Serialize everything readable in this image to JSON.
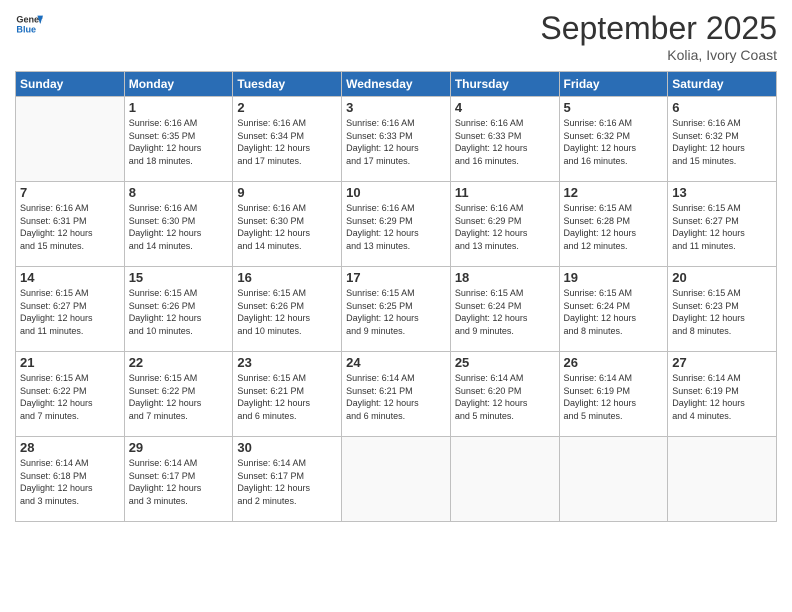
{
  "logo": {
    "line1": "General",
    "line2": "Blue"
  },
  "title": "September 2025",
  "subtitle": "Kolia, Ivory Coast",
  "days_header": [
    "Sunday",
    "Monday",
    "Tuesday",
    "Wednesday",
    "Thursday",
    "Friday",
    "Saturday"
  ],
  "weeks": [
    [
      {
        "day": "",
        "info": ""
      },
      {
        "day": "1",
        "info": "Sunrise: 6:16 AM\nSunset: 6:35 PM\nDaylight: 12 hours\nand 18 minutes."
      },
      {
        "day": "2",
        "info": "Sunrise: 6:16 AM\nSunset: 6:34 PM\nDaylight: 12 hours\nand 17 minutes."
      },
      {
        "day": "3",
        "info": "Sunrise: 6:16 AM\nSunset: 6:33 PM\nDaylight: 12 hours\nand 17 minutes."
      },
      {
        "day": "4",
        "info": "Sunrise: 6:16 AM\nSunset: 6:33 PM\nDaylight: 12 hours\nand 16 minutes."
      },
      {
        "day": "5",
        "info": "Sunrise: 6:16 AM\nSunset: 6:32 PM\nDaylight: 12 hours\nand 16 minutes."
      },
      {
        "day": "6",
        "info": "Sunrise: 6:16 AM\nSunset: 6:32 PM\nDaylight: 12 hours\nand 15 minutes."
      }
    ],
    [
      {
        "day": "7",
        "info": "Sunrise: 6:16 AM\nSunset: 6:31 PM\nDaylight: 12 hours\nand 15 minutes."
      },
      {
        "day": "8",
        "info": "Sunrise: 6:16 AM\nSunset: 6:30 PM\nDaylight: 12 hours\nand 14 minutes."
      },
      {
        "day": "9",
        "info": "Sunrise: 6:16 AM\nSunset: 6:30 PM\nDaylight: 12 hours\nand 14 minutes."
      },
      {
        "day": "10",
        "info": "Sunrise: 6:16 AM\nSunset: 6:29 PM\nDaylight: 12 hours\nand 13 minutes."
      },
      {
        "day": "11",
        "info": "Sunrise: 6:16 AM\nSunset: 6:29 PM\nDaylight: 12 hours\nand 13 minutes."
      },
      {
        "day": "12",
        "info": "Sunrise: 6:15 AM\nSunset: 6:28 PM\nDaylight: 12 hours\nand 12 minutes."
      },
      {
        "day": "13",
        "info": "Sunrise: 6:15 AM\nSunset: 6:27 PM\nDaylight: 12 hours\nand 11 minutes."
      }
    ],
    [
      {
        "day": "14",
        "info": "Sunrise: 6:15 AM\nSunset: 6:27 PM\nDaylight: 12 hours\nand 11 minutes."
      },
      {
        "day": "15",
        "info": "Sunrise: 6:15 AM\nSunset: 6:26 PM\nDaylight: 12 hours\nand 10 minutes."
      },
      {
        "day": "16",
        "info": "Sunrise: 6:15 AM\nSunset: 6:26 PM\nDaylight: 12 hours\nand 10 minutes."
      },
      {
        "day": "17",
        "info": "Sunrise: 6:15 AM\nSunset: 6:25 PM\nDaylight: 12 hours\nand 9 minutes."
      },
      {
        "day": "18",
        "info": "Sunrise: 6:15 AM\nSunset: 6:24 PM\nDaylight: 12 hours\nand 9 minutes."
      },
      {
        "day": "19",
        "info": "Sunrise: 6:15 AM\nSunset: 6:24 PM\nDaylight: 12 hours\nand 8 minutes."
      },
      {
        "day": "20",
        "info": "Sunrise: 6:15 AM\nSunset: 6:23 PM\nDaylight: 12 hours\nand 8 minutes."
      }
    ],
    [
      {
        "day": "21",
        "info": "Sunrise: 6:15 AM\nSunset: 6:22 PM\nDaylight: 12 hours\nand 7 minutes."
      },
      {
        "day": "22",
        "info": "Sunrise: 6:15 AM\nSunset: 6:22 PM\nDaylight: 12 hours\nand 7 minutes."
      },
      {
        "day": "23",
        "info": "Sunrise: 6:15 AM\nSunset: 6:21 PM\nDaylight: 12 hours\nand 6 minutes."
      },
      {
        "day": "24",
        "info": "Sunrise: 6:14 AM\nSunset: 6:21 PM\nDaylight: 12 hours\nand 6 minutes."
      },
      {
        "day": "25",
        "info": "Sunrise: 6:14 AM\nSunset: 6:20 PM\nDaylight: 12 hours\nand 5 minutes."
      },
      {
        "day": "26",
        "info": "Sunrise: 6:14 AM\nSunset: 6:19 PM\nDaylight: 12 hours\nand 5 minutes."
      },
      {
        "day": "27",
        "info": "Sunrise: 6:14 AM\nSunset: 6:19 PM\nDaylight: 12 hours\nand 4 minutes."
      }
    ],
    [
      {
        "day": "28",
        "info": "Sunrise: 6:14 AM\nSunset: 6:18 PM\nDaylight: 12 hours\nand 3 minutes."
      },
      {
        "day": "29",
        "info": "Sunrise: 6:14 AM\nSunset: 6:17 PM\nDaylight: 12 hours\nand 3 minutes."
      },
      {
        "day": "30",
        "info": "Sunrise: 6:14 AM\nSunset: 6:17 PM\nDaylight: 12 hours\nand 2 minutes."
      },
      {
        "day": "",
        "info": ""
      },
      {
        "day": "",
        "info": ""
      },
      {
        "day": "",
        "info": ""
      },
      {
        "day": "",
        "info": ""
      }
    ]
  ]
}
